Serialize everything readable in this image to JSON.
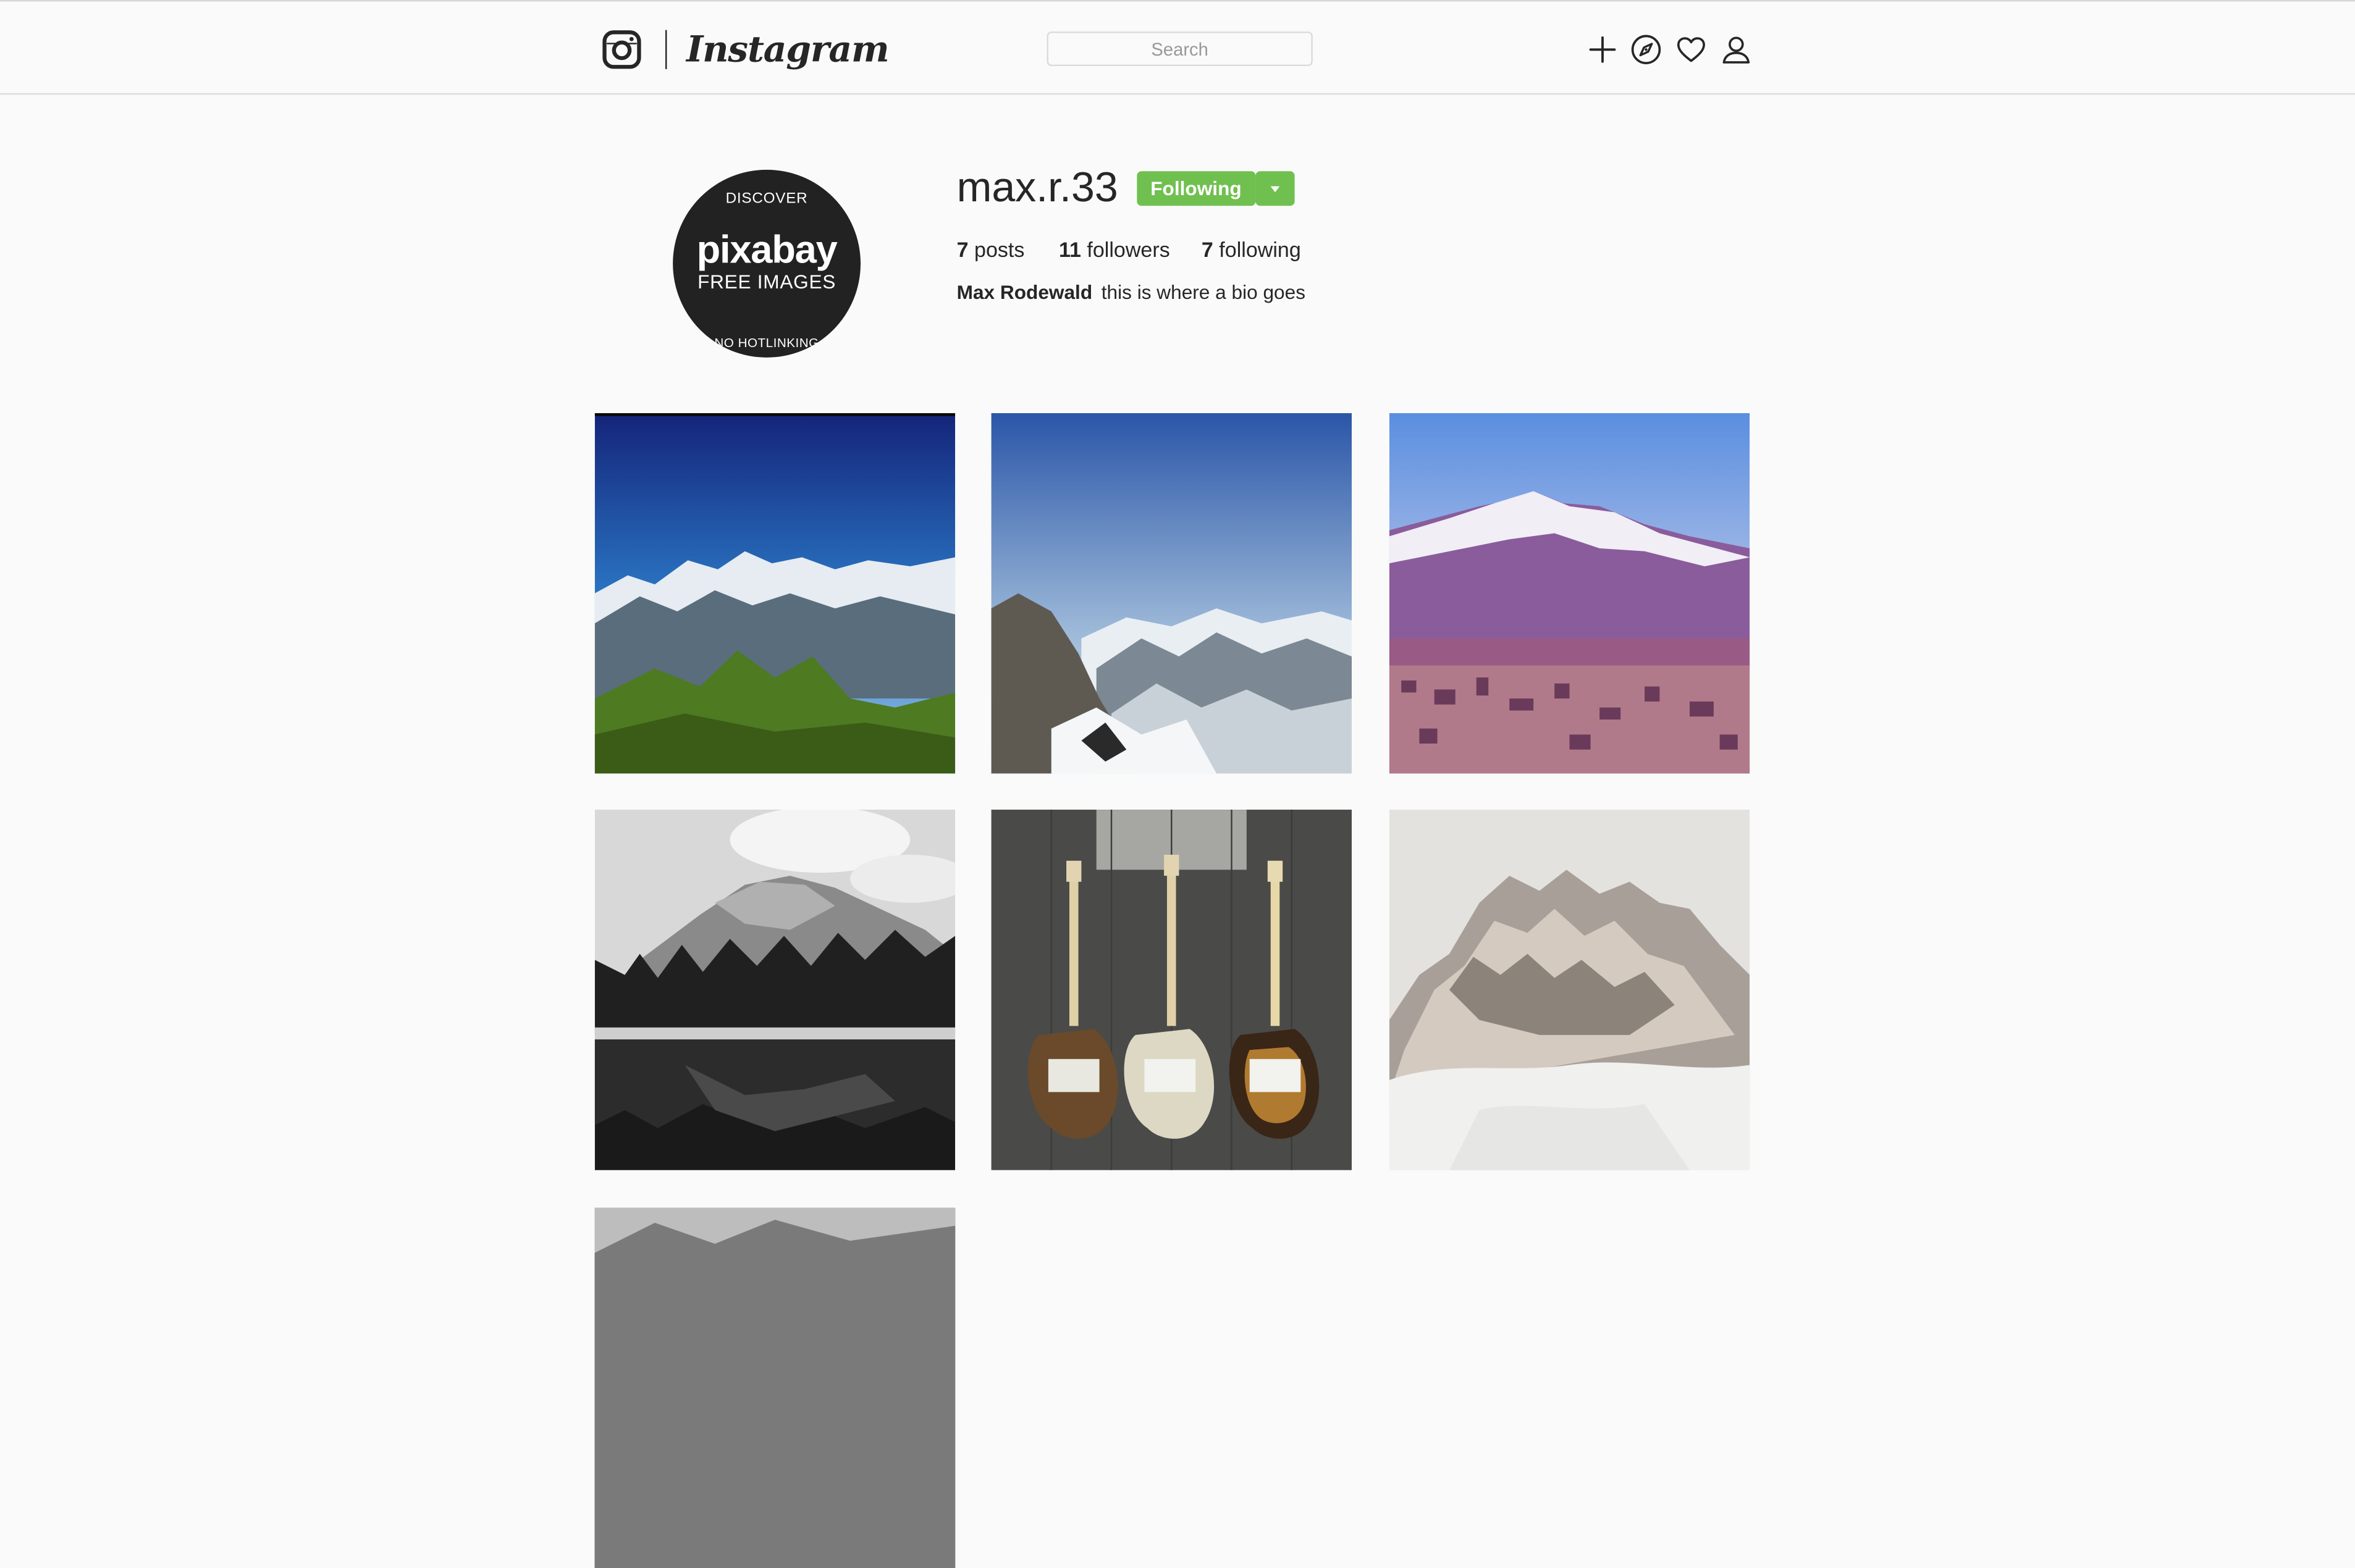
{
  "header": {
    "logo_text": "Instagram",
    "search_placeholder": "Search",
    "icons": [
      "plus-icon",
      "compass-icon",
      "heart-icon",
      "user-icon"
    ]
  },
  "profile": {
    "username": "max.r.33",
    "follow_label": "Following",
    "posts_count": "7",
    "posts_label": "posts",
    "followers_count": "11",
    "followers_label": "followers",
    "following_count": "7",
    "following_label": "following",
    "full_name": "Max Rodewald",
    "bio": "this is where a bio goes",
    "avatar": {
      "top": "DISCOVER",
      "brand": "pixabay",
      "middle": "FREE IMAGES",
      "bottom": "NO HOTLINKING"
    }
  },
  "posts": [
    {
      "subject": "green mountain with snowy peaks, blue sky"
    },
    {
      "subject": "snowy mountain range from a rocky summit"
    },
    {
      "subject": "snow-capped mountain above a city, purple tint"
    },
    {
      "subject": "black and white mountain reflected in a lake"
    },
    {
      "subject": "three electric guitars on a wooden floor"
    },
    {
      "subject": "rocky peaks above misty clouds"
    },
    {
      "subject": "partially visible grayscale post"
    }
  ],
  "colors": {
    "accent_green": "#70c050",
    "text": "#262626",
    "background": "#fafafa",
    "border": "#dbdbdb"
  }
}
